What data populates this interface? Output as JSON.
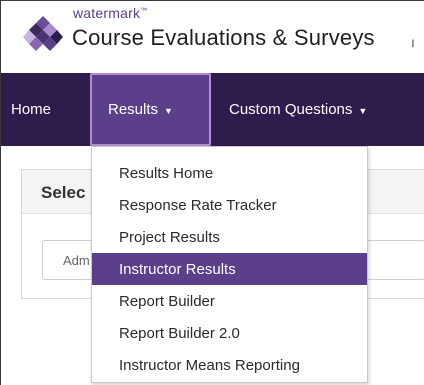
{
  "brand": {
    "company": "watermark",
    "trademark": "™",
    "product": "Course Evaluations & Surveys",
    "trailing": "ı"
  },
  "nav": {
    "home": "Home",
    "results": "Results",
    "custom_questions": "Custom Questions"
  },
  "panel": {
    "title": "Selec",
    "field_value": "Adm"
  },
  "results_menu": {
    "items": [
      {
        "label": "Results Home"
      },
      {
        "label": "Response Rate Tracker"
      },
      {
        "label": "Project Results"
      },
      {
        "label": "Instructor Results",
        "active": true
      },
      {
        "label": "Report Builder"
      },
      {
        "label": "Report Builder 2.0"
      },
      {
        "label": "Instructor Means Reporting"
      }
    ]
  },
  "colors": {
    "nav_bg": "#2e1d4c",
    "accent": "#5b3f8a",
    "active_border": "#b58bd6"
  }
}
